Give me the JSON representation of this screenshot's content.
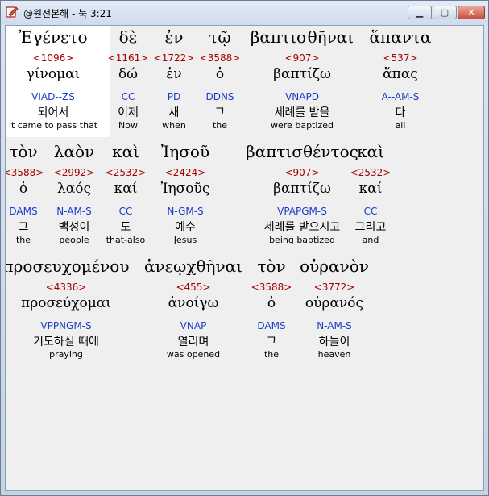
{
  "window": {
    "title": "@원전본해 - 눅 3:21",
    "minimize_label": "▁",
    "maximize_label": "▢",
    "close_label": "✕"
  },
  "icons": {
    "app": "book-quill-icon"
  },
  "colors": {
    "strong": "#a40000",
    "parse": "#1a3cc8",
    "text": "#000000"
  },
  "words": [
    {
      "greek": "Ἐγένετο",
      "strong": "<1096>",
      "lemma": "γίνομαι",
      "parse": "VIAD--ZS",
      "korean": "되어서",
      "english": "it came to pass that"
    },
    {
      "greek": "δὲ",
      "strong": "<1161>",
      "lemma": "δώ",
      "parse": "CC",
      "korean": "이제",
      "english": "Now"
    },
    {
      "greek": "ἐν",
      "strong": "<1722>",
      "lemma": "ἐν",
      "parse": "PD",
      "korean": "새",
      "english": "when"
    },
    {
      "greek": "τῷ",
      "strong": "<3588>",
      "lemma": "ὁ",
      "parse": "DDNS",
      "korean": "그",
      "english": "the"
    },
    {
      "greek": "βαπτισθῆναι",
      "strong": "<907>",
      "lemma": "βαπτίζω",
      "parse": "VNAPD",
      "korean": "세례를 받을",
      "english": "were baptized"
    },
    {
      "greek": "ἅπαντα",
      "strong": "<537>",
      "lemma": "ἅπας",
      "parse": "A--AM-S",
      "korean": "다",
      "english": "all"
    },
    {
      "greek": "τὸν",
      "strong": "<3588>",
      "lemma": "ὁ",
      "parse": "DAMS",
      "korean": "그",
      "english": "the"
    },
    {
      "greek": "λαὸν",
      "strong": "<2992>",
      "lemma": "λαός",
      "parse": "N-AM-S",
      "korean": "백성이",
      "english": "people"
    },
    {
      "greek": "καὶ",
      "strong": "<2532>",
      "lemma": "καί",
      "parse": "CC",
      "korean": "도",
      "english": "that-also"
    },
    {
      "greek": "Ἰησοῦ",
      "strong": "<2424>",
      "lemma": "Ἰησοῦς",
      "parse": "N-GM-S",
      "korean": "예수",
      "english": "Jesus"
    },
    {
      "greek": "βαπτισθέντος",
      "strong": "<907>",
      "lemma": "βαπτίζω",
      "parse": "VPAPGM-S",
      "korean": "세례를 받으시고",
      "english": "being baptized"
    },
    {
      "greek": "καὶ",
      "strong": "<2532>",
      "lemma": "καί",
      "parse": "CC",
      "korean": "그리고",
      "english": "and"
    },
    {
      "greek": "προσευχομένου",
      "strong": "<4336>",
      "lemma": "προσεύχομαι",
      "parse": "VPPNGM-S",
      "korean": "기도하실 때에",
      "english": "praying"
    },
    {
      "greek": "ἀνεῳχθῆναι",
      "strong": "<455>",
      "lemma": "ἀνοίγω",
      "parse": "VNAP",
      "korean": "열리며",
      "english": "was opened"
    },
    {
      "greek": "τὸν",
      "strong": "<3588>",
      "lemma": "ὁ",
      "parse": "DAMS",
      "korean": "그",
      "english": "the"
    },
    {
      "greek": "οὐρανὸν",
      "strong": "<3772>",
      "lemma": "οὐρανός",
      "parse": "N-AM-S",
      "korean": "하늘이",
      "english": "heaven"
    }
  ]
}
